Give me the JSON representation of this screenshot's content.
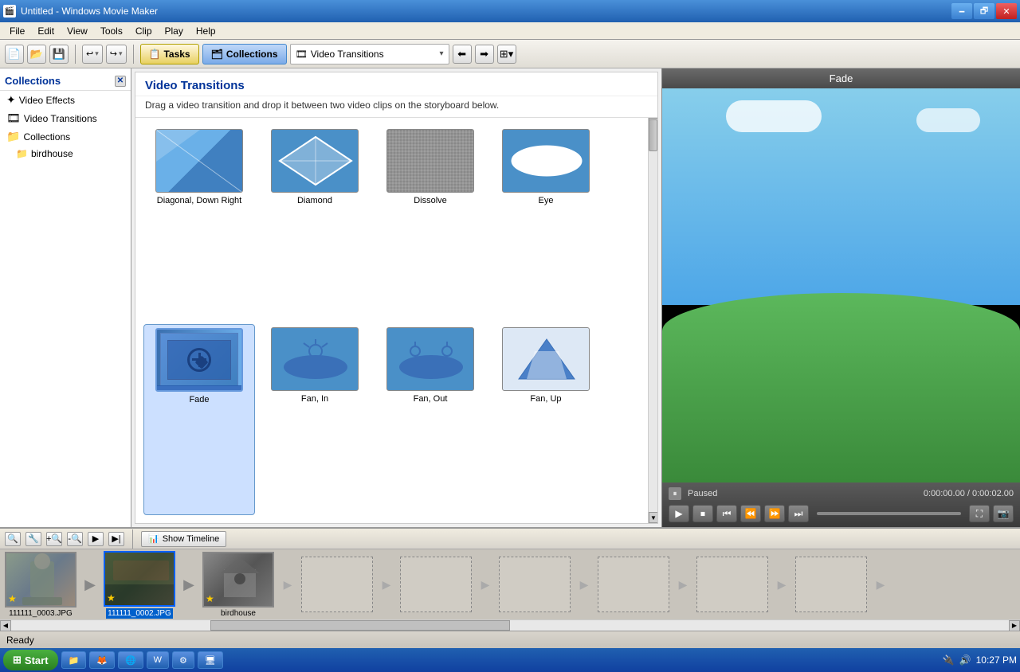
{
  "window": {
    "title": "Untitled - Windows Movie Maker",
    "icon": "🎬"
  },
  "titlebar": {
    "title": "Untitled - Windows Movie Maker",
    "min": "🗕",
    "max": "🗗",
    "close": "✕"
  },
  "menubar": {
    "items": [
      "File",
      "Edit",
      "View",
      "Tools",
      "Clip",
      "Play",
      "Help"
    ]
  },
  "toolbar": {
    "tasks_label": "Tasks",
    "collections_label": "Collections",
    "dropdown_label": "Video Transitions",
    "dropdown_icon": "🎞"
  },
  "sidebar": {
    "title": "Collections",
    "items": [
      {
        "label": "Video Effects",
        "icon": "✦"
      },
      {
        "label": "Video Transitions",
        "icon": "🎞"
      },
      {
        "label": "Collections",
        "icon": "📁"
      },
      {
        "label": "birdhouse",
        "icon": "📁",
        "sub": true
      }
    ]
  },
  "transitions_panel": {
    "title": "Video Transitions",
    "description": "Drag a video transition and drop it between two video clips on the storyboard below.",
    "items": [
      {
        "id": "diagonal-down-right",
        "label": "Diagonal, Down Right",
        "type": "diagonal"
      },
      {
        "id": "diamond",
        "label": "Diamond",
        "type": "diamond"
      },
      {
        "id": "dissolve",
        "label": "Dissolve",
        "type": "dissolve"
      },
      {
        "id": "eye",
        "label": "Eye",
        "type": "eye"
      },
      {
        "id": "fade",
        "label": "Fade",
        "type": "fade",
        "selected": true
      },
      {
        "id": "fan-in",
        "label": "Fan, In",
        "type": "fan-in"
      },
      {
        "id": "fan-out",
        "label": "Fan, Out",
        "type": "fan-out"
      },
      {
        "id": "fan-up",
        "label": "Fan, Up",
        "type": "fan-up"
      }
    ]
  },
  "preview": {
    "title": "Fade",
    "status": "Paused",
    "time": "0:00:00.00 / 0:00:02.00"
  },
  "storyboard": {
    "show_timeline_label": "Show Timeline",
    "clips": [
      {
        "id": "clip1",
        "label": "111111_0003.JPG",
        "type": "statue",
        "selected": false
      },
      {
        "id": "clip2",
        "label": "111111_0002.JPG",
        "type": "bird",
        "selected": true
      },
      {
        "id": "clip3",
        "label": "birdhouse",
        "type": "birdhouse",
        "selected": false
      }
    ]
  },
  "statusbar": {
    "text": "Ready"
  },
  "taskbar": {
    "start_label": "Start",
    "time": "10:27 PM",
    "apps": [
      "explorer",
      "firefox",
      "ie",
      "word",
      "controlpanel",
      "media"
    ]
  }
}
